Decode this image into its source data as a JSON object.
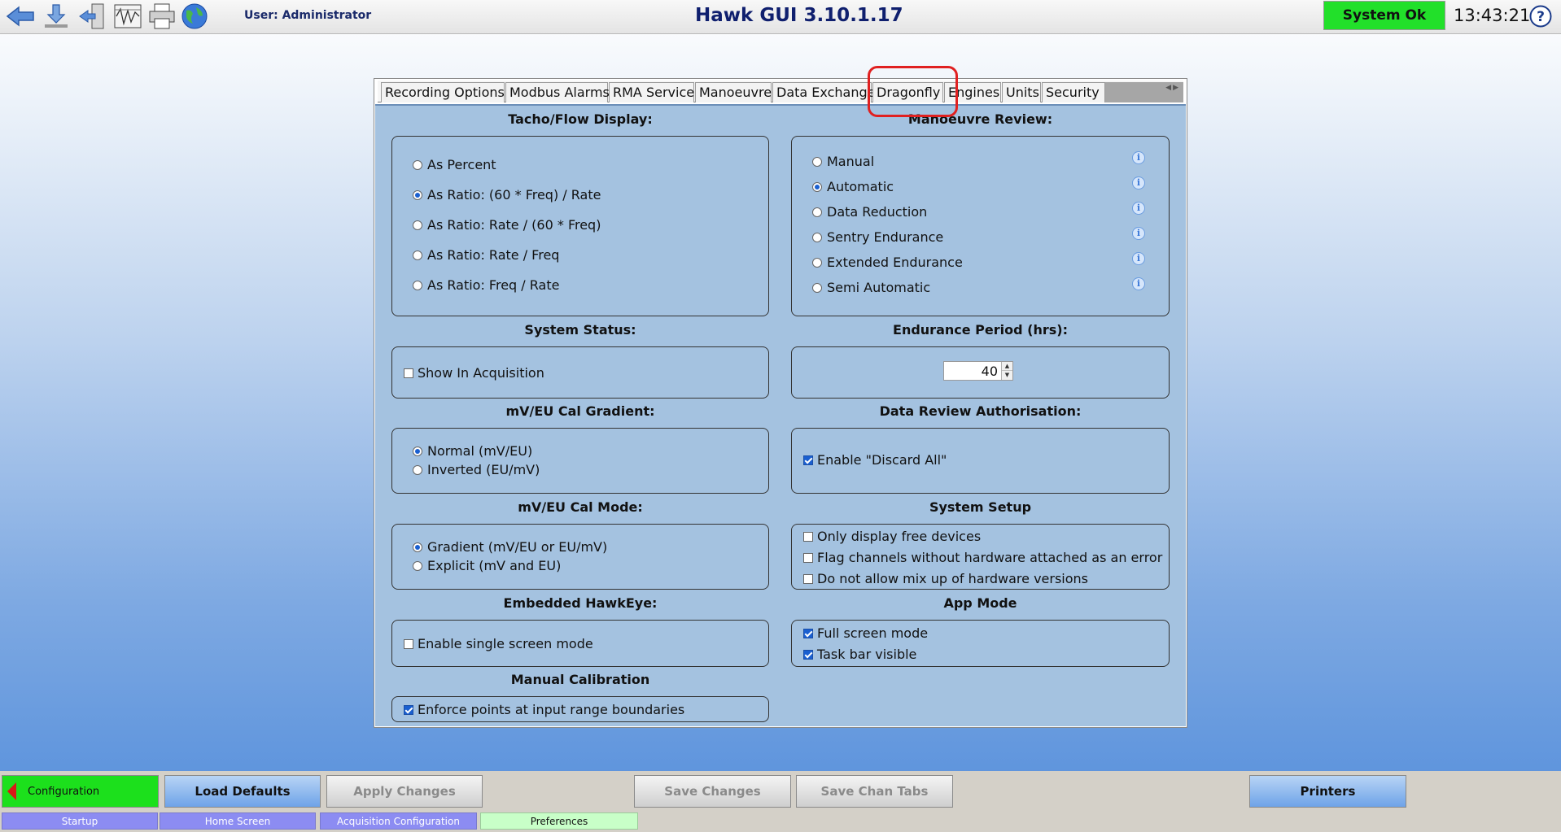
{
  "header": {
    "user": "User: Administrator",
    "title": "Hawk GUI 3.10.1.17",
    "status": "System Ok",
    "time": "13:43:21",
    "icons": [
      "back-arrow-icon",
      "download-icon",
      "logout-door-icon",
      "waveform-settings-icon",
      "printer-icon",
      "globe-icon",
      "help-icon"
    ]
  },
  "tabs": [
    "Recording Options",
    "Modbus Alarms",
    "RMA Service",
    "Manoeuvre",
    "Data Exchange",
    "Dragonfly",
    "Engines",
    "Units",
    "Security"
  ],
  "tacho": {
    "title": "Tacho/Flow Display:",
    "options": [
      {
        "label": "As Percent",
        "selected": false
      },
      {
        "label": "As Ratio: (60 * Freq) / Rate",
        "selected": true
      },
      {
        "label": "As Ratio: Rate / (60 * Freq)",
        "selected": false
      },
      {
        "label": "As Ratio: Rate / Freq",
        "selected": false
      },
      {
        "label": "As Ratio: Freq / Rate",
        "selected": false
      }
    ]
  },
  "manoeuvre": {
    "title": "Manoeuvre Review:",
    "options": [
      {
        "label": "Manual",
        "selected": false
      },
      {
        "label": "Automatic",
        "selected": true
      },
      {
        "label": "Data Reduction",
        "selected": false
      },
      {
        "label": "Sentry Endurance",
        "selected": false
      },
      {
        "label": "Extended Endurance",
        "selected": false
      },
      {
        "label": "Semi Automatic",
        "selected": false
      }
    ]
  },
  "system_status": {
    "title": "System Status:",
    "show_in_acquisition": "Show In Acquisition",
    "checked": false
  },
  "endurance": {
    "title": "Endurance Period (hrs):",
    "value": "40"
  },
  "gradient": {
    "title": "mV/EU Cal Gradient:",
    "options": [
      {
        "label": "Normal (mV/EU)",
        "selected": true
      },
      {
        "label": "Inverted (EU/mV)",
        "selected": false
      }
    ]
  },
  "authorisation": {
    "title": "Data Review Authorisation:",
    "discard_all": "Enable \"Discard All\"",
    "checked": true
  },
  "cal_mode": {
    "title": "mV/EU Cal Mode:",
    "options": [
      {
        "label": "Gradient (mV/EU or EU/mV)",
        "selected": true
      },
      {
        "label": "Explicit (mV and EU)",
        "selected": false
      }
    ]
  },
  "system_setup": {
    "title": "System Setup",
    "options": [
      {
        "label": "Only display free devices",
        "checked": false
      },
      {
        "label": "Flag channels without hardware attached as an error",
        "checked": false
      },
      {
        "label": "Do not allow mix up of hardware versions",
        "checked": false
      }
    ]
  },
  "hawkeye": {
    "title": "Embedded HawkEye:",
    "single_screen": "Enable single screen mode",
    "checked": false
  },
  "app_mode": {
    "title": "App Mode",
    "options": [
      {
        "label": "Full screen mode",
        "checked": true
      },
      {
        "label": "Task bar visible",
        "checked": true
      }
    ]
  },
  "manual_cal": {
    "title": "Manual Calibration",
    "enforce": "Enforce points at input range boundaries",
    "checked": true
  },
  "bottom": {
    "configuration": "Configuration",
    "load_defaults": "Load Defaults",
    "apply_changes": "Apply Changes",
    "save_changes": "Save Changes",
    "save_chan_tabs": "Save Chan Tabs",
    "printers": "Printers",
    "nav": [
      "Startup",
      "Home Screen",
      "Acquisition Configuration",
      "Preferences"
    ],
    "active_nav": "Preferences"
  },
  "colors": {
    "status_ok": "#22e02a",
    "accent_blue": "#1a5fd0",
    "highlight": "#e02020",
    "panel_bg": "#a4c2e0"
  }
}
